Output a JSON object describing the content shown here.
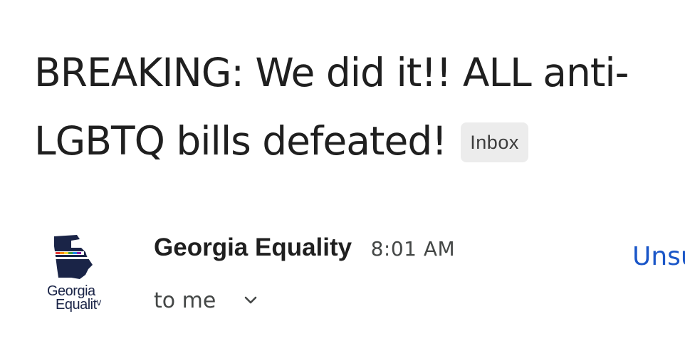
{
  "email": {
    "subject_line1": "BREAKING: We did it!! ALL anti-",
    "subject_line2": "LGBTQ bills defeated!",
    "label_chip": "Inbox"
  },
  "sender": {
    "name": "Georgia Equality",
    "time": "8:01 AM",
    "recipient": "to me",
    "avatar_logo_line1": "Georgia",
    "avatar_logo_line2": "Equalitᵛ",
    "avatar_icon": "georgia-state-logo-icon"
  },
  "actions": {
    "unsubscribe_label": "Unsu"
  },
  "colors": {
    "text_primary": "#1f1f1f",
    "text_secondary": "#444746",
    "chip_bg": "#ececec",
    "link": "#1a56c8",
    "logo_navy": "#1a2447"
  }
}
